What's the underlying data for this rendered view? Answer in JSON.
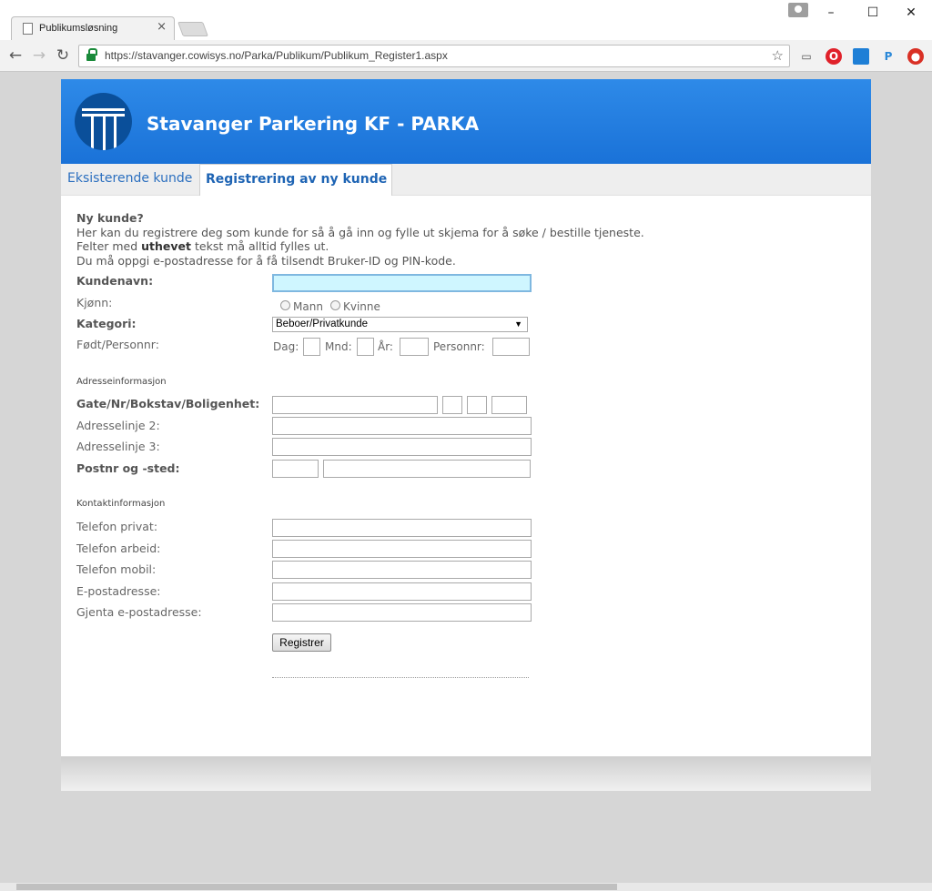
{
  "browser": {
    "tab_title": "Publikumsløsning",
    "tab_close": "×",
    "url": "https://stavanger.cowisys.no/Parka/Publikum/Publikum_Register1.aspx",
    "window_min": "–",
    "window_max": "☐",
    "window_close": "✕",
    "ext_p": "P"
  },
  "site": {
    "title": "Stavanger Parkering KF - PARKA"
  },
  "tabs": [
    {
      "label": "Eksisterende kunde",
      "active": false
    },
    {
      "label": "Registrering av ny kunde",
      "active": true
    }
  ],
  "intro": {
    "heading": "Ny kunde?",
    "line1": "Her kan du registrere deg som kunde for så å gå inn og fylle ut skjema for å søke / bestille tjeneste.",
    "line2_before": "Felter med ",
    "line2_bold": "uthevet",
    "line2_after": " tekst må alltid fylles ut.",
    "line3": "Du må oppgi e-postadresse for å få tilsendt Bruker-ID og PIN-kode."
  },
  "form": {
    "kundenavn_label": "Kundenavn:",
    "kundenavn_value": "",
    "kjonn_label": "Kjønn:",
    "gender_options": [
      "Mann",
      "Kvinne"
    ],
    "kategori_label": "Kategori:",
    "kategori_value": "Beboer/Privatkunde",
    "fodt_label": "Født/Personnr:",
    "dag_label": "Dag:",
    "mnd_label": "Mnd:",
    "ar_label": "År:",
    "personnr_label": "Personnr:",
    "adresse_section": "Adresseinformasjon",
    "gate_label": "Gate/Nr/Bokstav/Boligenhet:",
    "adresse2_label": "Adresselinje 2:",
    "adresse3_label": "Adresselinje 3:",
    "postnr_label": "Postnr og -sted:",
    "kontakt_section": "Kontaktinformasjon",
    "tlf_privat_label": "Telefon privat:",
    "tlf_arbeid_label": "Telefon arbeid:",
    "tlf_mobil_label": "Telefon mobil:",
    "epost_label": "E-postadresse:",
    "epost2_label": "Gjenta e-postadresse:",
    "submit_label": "Registrer"
  }
}
